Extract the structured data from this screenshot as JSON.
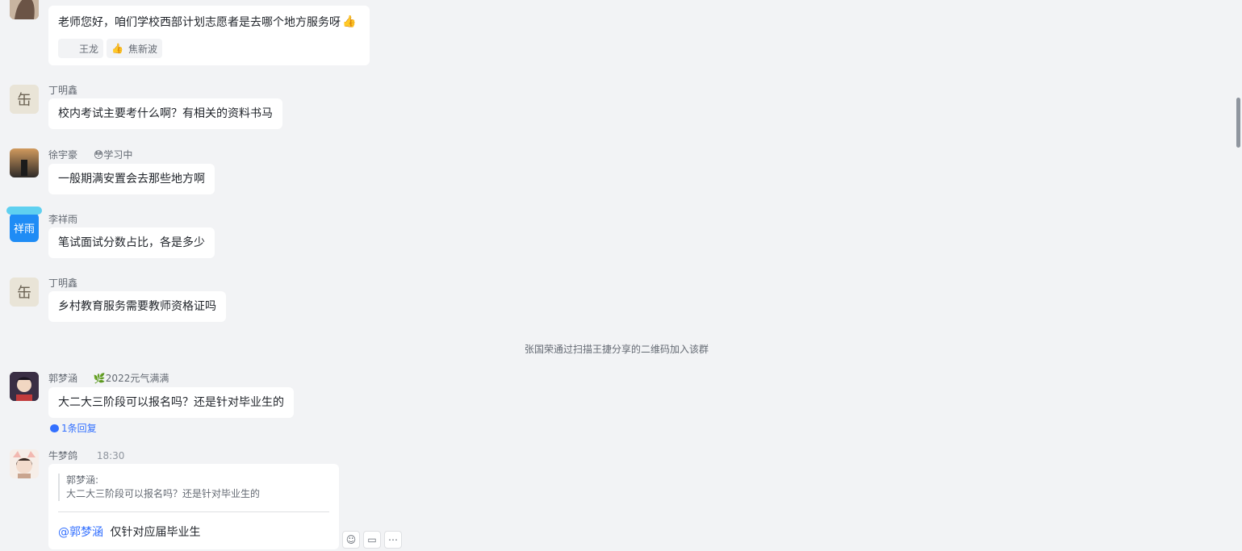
{
  "messages": [
    {
      "text": "老师您好，咱们学校西部计划志愿者是去哪个地方服务呀",
      "reactions": [
        {
          "label": "王龙"
        },
        {
          "label": "焦新波"
        }
      ]
    },
    {
      "sender": "丁明鑫",
      "text": "校内考试主要考什么啊？有相关的资料书马"
    },
    {
      "sender": "徐宇豪",
      "badge": "😳学习中",
      "text": "一般期满安置会去那些地方啊"
    },
    {
      "sender": "李祥雨",
      "avatar_text": "祥雨",
      "text": "笔试面试分数占比，各是多少"
    },
    {
      "sender": "丁明鑫",
      "text": "乡村教育服务需要教师资格证吗"
    },
    {
      "sender": "郭梦涵",
      "badge": "2022元气满满",
      "text": "大二大三阶段可以报名吗？还是针对毕业生的",
      "replies": "1条回复"
    },
    {
      "sender": "牛梦鸽",
      "time": "18:30",
      "quote_author": "郭梦涵:",
      "quote_text": "大二大三阶段可以报名吗？还是针对毕业生的",
      "mention": "@郭梦涵",
      "text": "仅针对应届毕业生"
    }
  ],
  "system_message": "张国荣通过扫描王捷分享的二维码加入该群",
  "colors": {
    "accent": "#3370ff",
    "background": "#f2f3f5",
    "bubble": "#ffffff"
  }
}
